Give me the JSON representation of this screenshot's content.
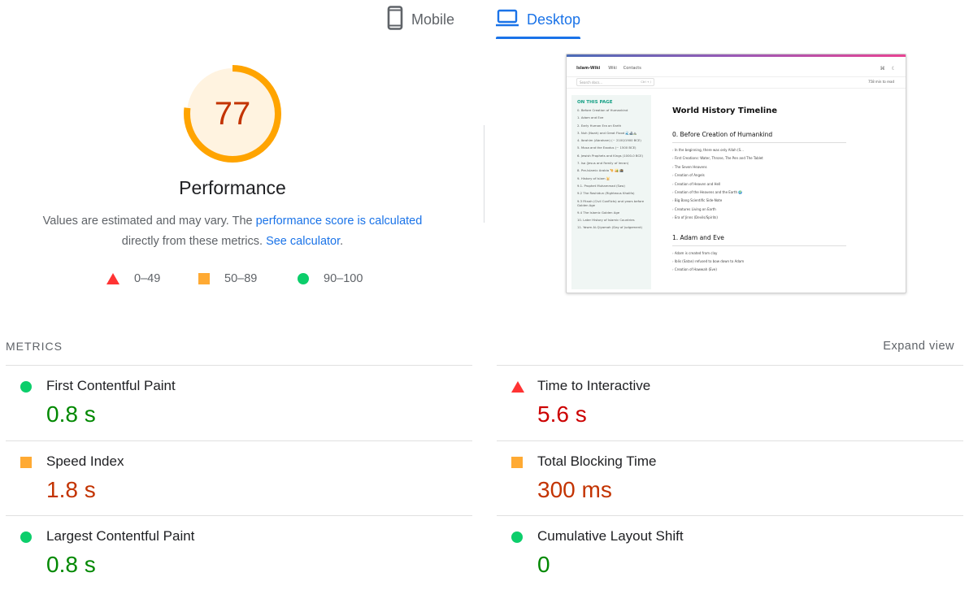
{
  "tabs": {
    "mobile": {
      "label": "Mobile",
      "icon": "smartphone-icon"
    },
    "desktop": {
      "label": "Desktop",
      "icon": "laptop-icon",
      "active": true
    }
  },
  "performance": {
    "score": "77",
    "score_fraction": 0.77,
    "title": "Performance",
    "desc_prefix": "Values are estimated and may vary. The ",
    "desc_link": "performance score is calculated",
    "desc_middle": " directly from these metrics. ",
    "desc_link2": "See calculator",
    "desc_suffix": ".",
    "gauge_color": "#ffa400",
    "gauge_bg": "#fff3e0",
    "score_color": "#c33300"
  },
  "legend": [
    {
      "shape": "triangle",
      "label": "0–49",
      "color": "#ff3333"
    },
    {
      "shape": "square",
      "label": "50–89",
      "color": "#ffaa33"
    },
    {
      "shape": "circle",
      "label": "90–100",
      "color": "#0cce6b"
    }
  ],
  "screenshot": {
    "brand": "Islam-Wiki",
    "nav": [
      "Wiki",
      "Contacts"
    ],
    "search_placeholder": "Search docs...",
    "search_shortcut": "Ctrl + /",
    "read_time": "758 min to read",
    "sidebar_title": "ON THIS PAGE",
    "sidebar_items": [
      "0. Before Creation of Humankind",
      "1. Adam and Eve",
      "2. Early Human Era on Earth",
      "3. Nuh (Noah) and Great Flood 🌊🚢⛰️",
      "4. Ibrahim (Abraham) (~ 2100/1900 BCE)",
      "5. Musa and the Exodus (~ 1500 BCE)",
      "6. Jewish Prophets and Kings (1000-0 BCE)",
      "7. Isa (Jesus and Family of Imran)",
      "8. Pre-Islamic Arabia 🐪 🏜️ 🕋",
      "9. History of Islam 🕌",
      "9.1. Prophet Muhammad (Saw)",
      "9.2 The Rashidun (Righteous Khalifa)",
      "9.3 Fitnah (Civil Conflicts) and years before Golden Age",
      "9.4 The Islamic Golden Age",
      "10. Later History of Islamic Countries",
      "11. Yawm Al-Qiyamah (Day of Judgement)"
    ],
    "page_title": "World History Timeline",
    "section0_title": "0. Before Creation of Humankind",
    "section0_items": [
      "In the beginning, there was only Allah (S...",
      "First Creations: Water, Throne, The Pen and The Tablet",
      "The Seven Heavens",
      "Creation of Angels",
      "Creation of Heaven and Hell",
      "Creation of the Heavens and the Earth 🌍",
      "Big Bang Scientific Side-Note",
      "Creatures Living on Earth",
      "Era of Jinns (Devils/Spirits)"
    ],
    "section1_title": "1. Adam and Eve",
    "section1_items": [
      "Adam is created from clay",
      "Iblis (Satan) refused to bow down to Adam",
      "Creation of Hawwah (Eve)"
    ]
  },
  "metrics": {
    "header": "METRICS",
    "expand": "Expand view",
    "items": [
      {
        "name": "First Contentful Paint",
        "value": "0.8 s",
        "rating": "pass"
      },
      {
        "name": "Time to Interactive",
        "value": "5.6 s",
        "rating": "fail"
      },
      {
        "name": "Speed Index",
        "value": "1.8 s",
        "rating": "average"
      },
      {
        "name": "Total Blocking Time",
        "value": "300 ms",
        "rating": "average"
      },
      {
        "name": "Largest Contentful Paint",
        "value": "0.8 s",
        "rating": "pass"
      },
      {
        "name": "Cumulative Layout Shift",
        "value": "0",
        "rating": "pass"
      }
    ]
  }
}
